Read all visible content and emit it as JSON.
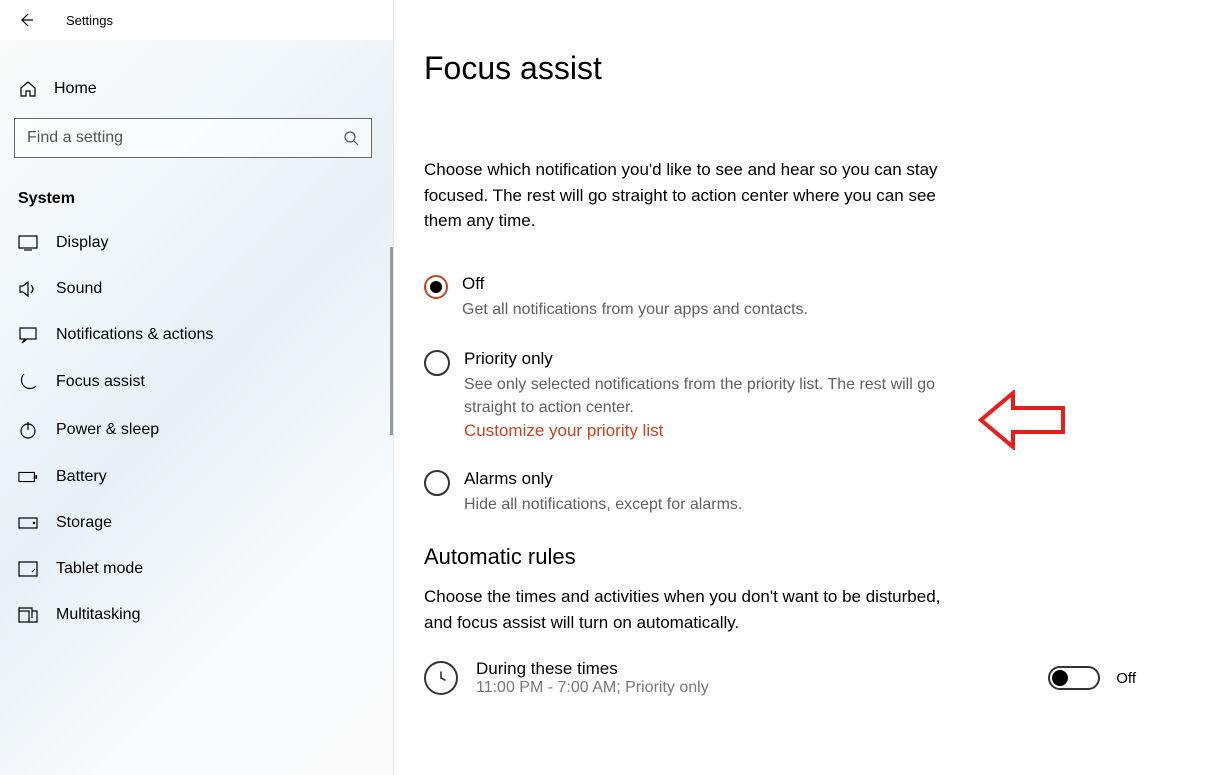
{
  "app_title": "Settings",
  "home_label": "Home",
  "search_placeholder": "Find a setting",
  "section_header": "System",
  "sidebar": {
    "items": [
      {
        "label": "Display"
      },
      {
        "label": "Sound"
      },
      {
        "label": "Notifications & actions"
      },
      {
        "label": "Focus assist"
      },
      {
        "label": "Power & sleep"
      },
      {
        "label": "Battery"
      },
      {
        "label": "Storage"
      },
      {
        "label": "Tablet mode"
      },
      {
        "label": "Multitasking"
      }
    ]
  },
  "page": {
    "title": "Focus assist",
    "intro": "Choose which notification you'd like to see and hear so you can stay focused. The rest will go straight to action center where you can see them any time.",
    "options": {
      "off": {
        "title": "Off",
        "desc": "Get all notifications from your apps and contacts."
      },
      "priority": {
        "title": "Priority only",
        "desc": "See only selected notifications from the priority list. The rest will go straight to action center.",
        "link": "Customize your priority list"
      },
      "alarms": {
        "title": "Alarms only",
        "desc": "Hide all notifications, except for alarms."
      }
    },
    "rules": {
      "heading": "Automatic rules",
      "intro": "Choose the times and activities when you don't want to be disturbed, and focus assist will turn on automatically.",
      "time_rule": {
        "title": "During these times",
        "subtitle": "11:00 PM - 7:00 AM; Priority only",
        "toggle_label": "Off"
      }
    }
  }
}
